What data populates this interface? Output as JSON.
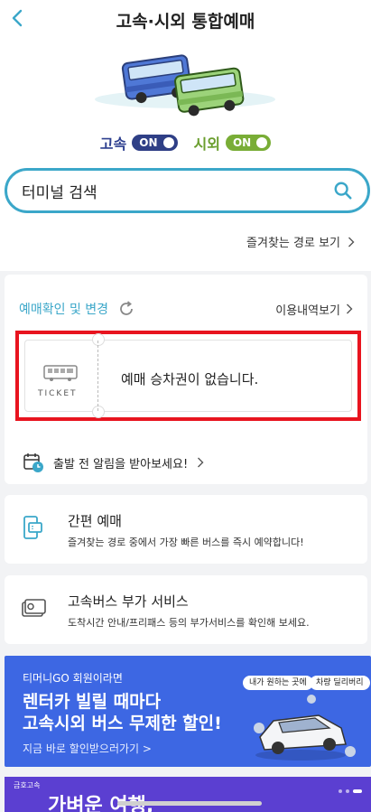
{
  "header": {
    "title": "고속·시외 통합예매",
    "back_icon": "chevron-left-icon"
  },
  "toggles": {
    "express": {
      "label": "고속",
      "state": "ON"
    },
    "intercity": {
      "label": "시외",
      "state": "ON"
    }
  },
  "search": {
    "placeholder": "터미널 검색",
    "icon": "search-icon"
  },
  "favorites_link": "즐겨찾는 경로 보기",
  "booking": {
    "title": "예매확인 및 변경",
    "history_link": "이용내역보기",
    "ticket_label": "TICKET",
    "empty_message": "예매 승차권이 없습니다.",
    "alarm_text": "출발 전 알림을 받아보세요!"
  },
  "quick_booking": {
    "title": "간편 예매",
    "desc": "즐겨찾는 경로 중에서 가장 빠른 버스를 즉시 예약합니다!"
  },
  "extra_service": {
    "title": "고속버스 부가 서비스",
    "desc": "도착시간 안내/프리패스 등의 부가서비스를 확인해 보세요."
  },
  "promo_banner": {
    "sub": "티머니GO 회원이라면",
    "line1": "렌터카 빌릴 때마다",
    "line2_a": "고속시외 버스 ",
    "line2_b": "무제한 할인!",
    "cta": "지금 바로 할인받으러가기 >",
    "bubble1": "내가 원하는 곳에",
    "bubble2": "차량 딜리버리"
  },
  "banner2": {
    "brand": "금호고속",
    "title": "가벼운 여행,"
  },
  "colors": {
    "accent": "#3ba7c9",
    "navy": "#2f3f86",
    "green": "#79ad36",
    "highlight": "#e8141f",
    "banner": "#3d67e3"
  }
}
